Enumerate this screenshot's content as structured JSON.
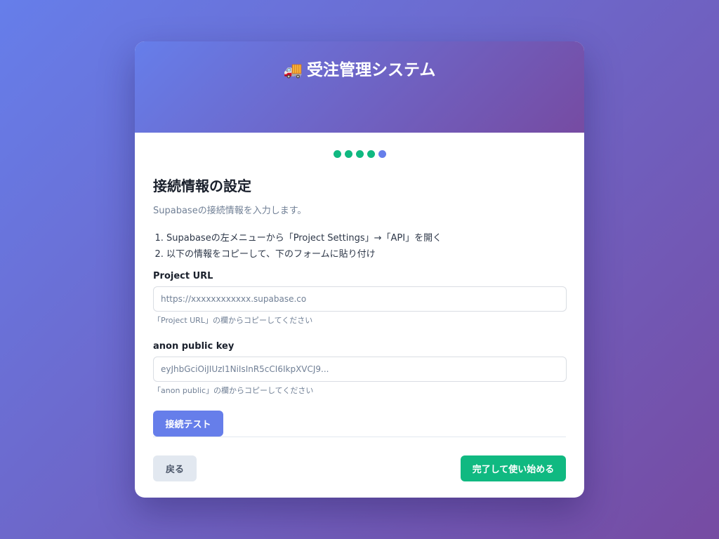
{
  "header": {
    "icon": "truck-icon",
    "title": "受注管理システム",
    "subtitle": ""
  },
  "steps": {
    "total": 5,
    "current": 5,
    "completed_color": "#10b981",
    "current_color": "#667eea"
  },
  "section": {
    "title": "接続情報の設定",
    "description": "Supabaseの接続情報を入力します。",
    "instructions": [
      "Supabaseの左メニューから「Project Settings」→「API」を開く",
      "以下の情報をコピーして、下のフォームに貼り付け"
    ]
  },
  "form": {
    "url_label": "Project URL",
    "url_value": "",
    "url_placeholder": "https://xxxxxxxxxxxx.supabase.co",
    "url_hint": "「Project URL」の欄からコピーしてください",
    "key_label": "anon public key",
    "key_value": "",
    "key_placeholder": "eyJhbGciOiJIUzI1NiIsInR5cCI6IkpXVCJ9...",
    "key_hint": "「anon public」の欄からコピーしてください",
    "test_button": "接続テスト"
  },
  "footer": {
    "back_button": "戻る",
    "finish_button": "完了して使い始める"
  },
  "colors": {
    "accent": "#667eea",
    "success": "#10b981",
    "gradient_end": "#764ba2"
  }
}
